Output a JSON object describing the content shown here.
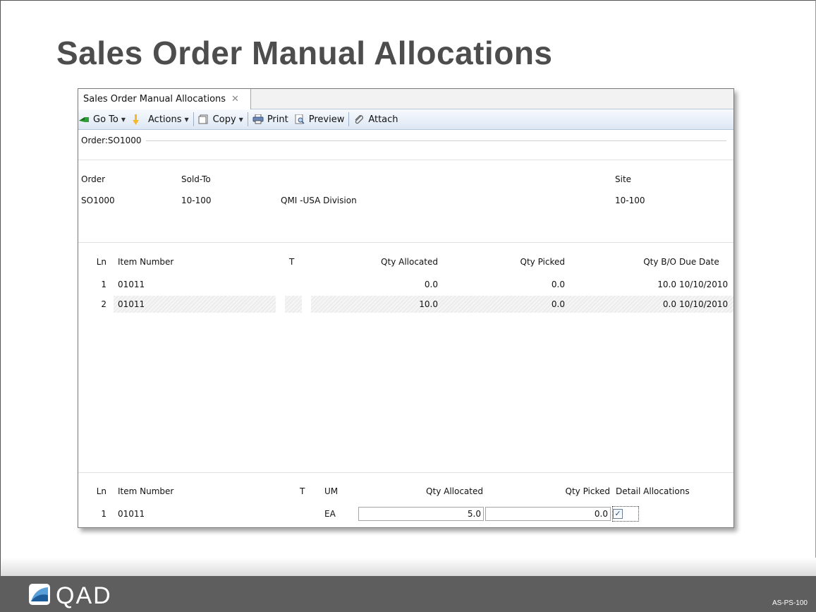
{
  "slide": {
    "title": "Sales Order Manual Allocations",
    "logo_text": "QAD",
    "course_code": "AS-PS-100"
  },
  "app": {
    "tab_label": "Sales Order Manual Allocations",
    "tab_close": "✕",
    "toolbar": {
      "goto": "Go To",
      "actions": "Actions",
      "copy": "Copy",
      "print": "Print",
      "preview": "Preview",
      "attach": "Attach"
    },
    "order_strip": "Order:SO1000",
    "header": {
      "order_label": "Order",
      "soldto_label": "Sold-To",
      "site_label": "Site",
      "order_value": "SO1000",
      "soldto_value": "10-100",
      "soldto_name": "QMI -USA Division",
      "site_value": "10-100"
    },
    "lines_grid": {
      "columns": {
        "ln": "Ln",
        "item": "Item Number",
        "t": "T",
        "qty_alloc": "Qty Allocated",
        "qty_picked": "Qty Picked",
        "qty_bo": "Qty B/O",
        "due": "Due Date"
      },
      "rows": [
        {
          "ln": "1",
          "item": "01011",
          "t": "",
          "qty_alloc": "0.0",
          "qty_picked": "0.0",
          "qty_bo": "10.0",
          "due": "10/10/2010"
        },
        {
          "ln": "2",
          "item": "01011",
          "t": "",
          "qty_alloc": "10.0",
          "qty_picked": "0.0",
          "qty_bo": "0.0",
          "due": "10/10/2010"
        }
      ]
    },
    "detail_grid": {
      "columns": {
        "ln": "Ln",
        "item": "Item Number",
        "t": "T",
        "um": "UM",
        "qty_alloc": "Qty Allocated",
        "qty_picked": "Qty Picked",
        "detail_alloc": "Detail Allocations"
      },
      "row": {
        "ln": "1",
        "item": "01011",
        "t": "",
        "um": "EA",
        "qty_alloc": "5.0",
        "qty_picked": "0.0",
        "detail_alloc_checked": true
      }
    }
  },
  "icons": {
    "goto": "go-to-icon",
    "actions": "actions-icon",
    "copy": "copy-icon",
    "print": "printer-icon",
    "preview": "preview-icon",
    "attach": "paperclip-icon",
    "logo": "qad-logo-icon"
  },
  "colors": {
    "title": "#4d4d4d",
    "footer": "#5e5e5e",
    "toolbar_top": "#f7fafe",
    "toolbar_bottom": "#dde7f3"
  }
}
